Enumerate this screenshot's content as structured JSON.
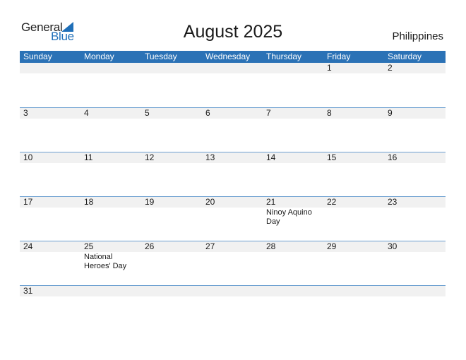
{
  "logo": {
    "word1": "General",
    "word2": "Blue",
    "accent_color": "#1f6fb8"
  },
  "title": "August 2025",
  "country": "Philippines",
  "colors": {
    "header_bg": "#2b72b6",
    "day_band": "#f1f1f1",
    "row_border": "#6b9fd0"
  },
  "weekdays": [
    "Sunday",
    "Monday",
    "Tuesday",
    "Wednesday",
    "Thursday",
    "Friday",
    "Saturday"
  ],
  "weeks": [
    [
      {
        "day": ""
      },
      {
        "day": ""
      },
      {
        "day": ""
      },
      {
        "day": ""
      },
      {
        "day": ""
      },
      {
        "day": "1"
      },
      {
        "day": "2"
      }
    ],
    [
      {
        "day": "3"
      },
      {
        "day": "4"
      },
      {
        "day": "5"
      },
      {
        "day": "6"
      },
      {
        "day": "7"
      },
      {
        "day": "8"
      },
      {
        "day": "9"
      }
    ],
    [
      {
        "day": "10"
      },
      {
        "day": "11"
      },
      {
        "day": "12"
      },
      {
        "day": "13"
      },
      {
        "day": "14"
      },
      {
        "day": "15"
      },
      {
        "day": "16"
      }
    ],
    [
      {
        "day": "17"
      },
      {
        "day": "18"
      },
      {
        "day": "19"
      },
      {
        "day": "20"
      },
      {
        "day": "21",
        "holiday": "Ninoy Aquino Day"
      },
      {
        "day": "22"
      },
      {
        "day": "23"
      }
    ],
    [
      {
        "day": "24"
      },
      {
        "day": "25",
        "holiday": "National Heroes' Day"
      },
      {
        "day": "26"
      },
      {
        "day": "27"
      },
      {
        "day": "28"
      },
      {
        "day": "29"
      },
      {
        "day": "30"
      }
    ],
    [
      {
        "day": "31"
      },
      {
        "day": ""
      },
      {
        "day": ""
      },
      {
        "day": ""
      },
      {
        "day": ""
      },
      {
        "day": ""
      },
      {
        "day": ""
      }
    ]
  ]
}
